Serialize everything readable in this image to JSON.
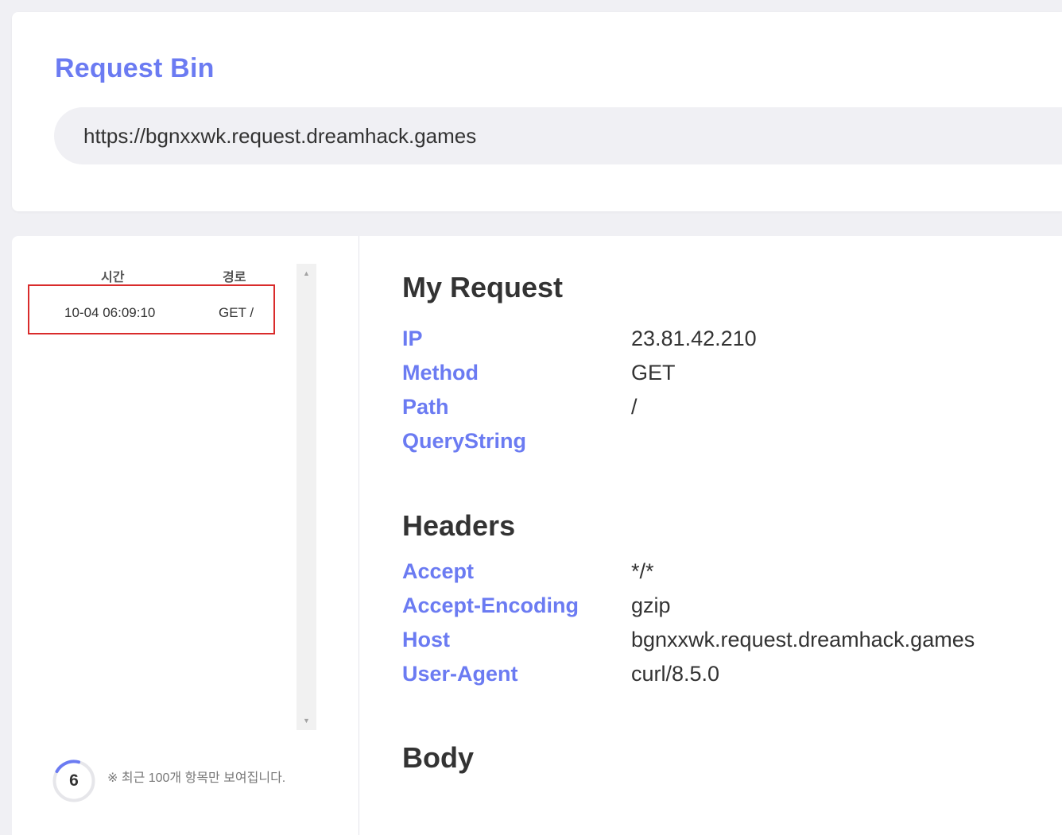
{
  "app": {
    "title": "Request Bin",
    "bin_url": "https://bgnxxwk.request.dreamhack.games"
  },
  "request_list": {
    "columns": {
      "time": "시간",
      "path": "경로"
    },
    "rows": [
      {
        "time": "10-04 06:09:10",
        "path": "GET /"
      }
    ],
    "counter": "6",
    "note": "※ 최근 100개 항목만 보여집니다."
  },
  "detail": {
    "my_request": {
      "title": "My Request",
      "fields": [
        {
          "key": "IP",
          "value": "23.81.42.210"
        },
        {
          "key": "Method",
          "value": "GET"
        },
        {
          "key": "Path",
          "value": "/"
        },
        {
          "key": "QueryString",
          "value": ""
        }
      ]
    },
    "headers": {
      "title": "Headers",
      "fields": [
        {
          "key": "Accept",
          "value": "*/*"
        },
        {
          "key": "Accept-Encoding",
          "value": "gzip"
        },
        {
          "key": "Host",
          "value": "bgnxxwk.request.dreamhack.games"
        },
        {
          "key": "User-Agent",
          "value": "curl/8.5.0"
        }
      ]
    },
    "body": {
      "title": "Body"
    }
  },
  "colors": {
    "accent": "#6b7bf2",
    "selected_border": "#d92b2b",
    "background": "#f0f0f4"
  }
}
